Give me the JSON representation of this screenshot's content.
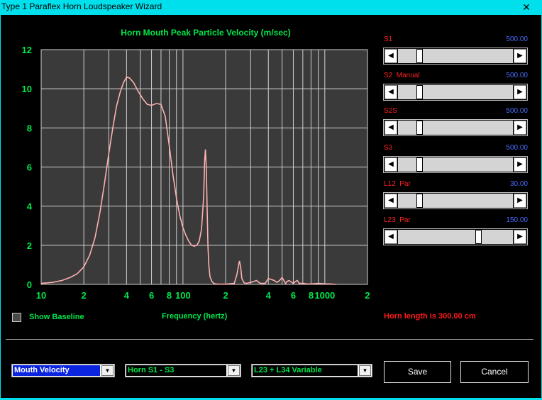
{
  "window": {
    "title": "Type 1 Paraflex Horn Loudspeaker Wizard",
    "close_glyph": "✕"
  },
  "chart_data": {
    "type": "line",
    "title": "Horn Mouth Peak Particle Velocity (m/sec)",
    "xlabel": "Frequency (hertz)",
    "ylabel": "",
    "xscale": "log",
    "xlim": [
      10,
      2000
    ],
    "ylim": [
      0,
      12
    ],
    "y_ticks": [
      "0",
      "2",
      "4",
      "6",
      "8",
      "10",
      "12"
    ],
    "x_tick_labels": [
      "10",
      "2",
      "4",
      "6",
      "8",
      "100",
      "2",
      "4",
      "6",
      "8",
      "1000",
      "2"
    ],
    "grid": true,
    "series": [
      {
        "color": "#ffb0b0",
        "x": [
          10,
          12,
          14,
          16,
          18,
          20,
          22,
          24,
          26,
          28,
          30,
          32,
          34,
          36,
          38,
          40,
          42,
          45,
          48,
          52,
          56,
          60,
          65,
          70,
          75,
          80,
          85,
          90,
          95,
          100,
          105,
          110,
          115,
          120,
          125,
          130,
          135,
          140,
          142,
          144,
          146,
          148,
          150,
          152,
          155,
          160,
          165,
          170,
          180,
          200,
          230,
          240,
          250,
          255,
          260,
          270,
          280,
          300,
          330,
          350,
          380,
          400,
          420,
          440,
          460,
          480,
          500,
          520,
          530,
          540,
          560,
          600,
          620,
          640,
          660,
          700,
          750,
          800,
          900,
          1000,
          1100,
          1200
        ],
        "y": [
          0.05,
          0.1,
          0.2,
          0.35,
          0.55,
          0.9,
          1.5,
          2.4,
          3.7,
          5.2,
          6.7,
          8.0,
          9.1,
          9.8,
          10.3,
          10.6,
          10.55,
          10.3,
          9.9,
          9.5,
          9.2,
          9.15,
          9.25,
          9.2,
          8.6,
          7.1,
          5.6,
          4.4,
          3.5,
          2.9,
          2.5,
          2.2,
          2.0,
          1.95,
          2.0,
          2.2,
          2.8,
          4.5,
          6.3,
          6.9,
          6.0,
          4.0,
          2.0,
          1.0,
          0.4,
          0.15,
          0.05,
          0.02,
          0.01,
          0.01,
          0.05,
          0.5,
          1.2,
          0.9,
          0.3,
          0.08,
          0.05,
          0.1,
          0.2,
          0.05,
          0.05,
          0.3,
          0.25,
          0.2,
          0.1,
          0.2,
          0.35,
          0.15,
          0.05,
          0.15,
          0.2,
          0.05,
          0.15,
          0.2,
          0.05,
          0.05,
          0.02,
          0.02,
          0.05,
          0.03,
          0.02,
          0.0
        ]
      }
    ]
  },
  "sliders": [
    {
      "label": "S1",
      "value": "500.00",
      "fraction": 0.17
    },
    {
      "label": "S2  Manual",
      "value": "500.00",
      "fraction": 0.17
    },
    {
      "label": "S2S",
      "value": "500.00",
      "fraction": 0.17
    },
    {
      "label": "S3",
      "value": "500.00",
      "fraction": 0.17
    },
    {
      "label": "L12  Par",
      "value": "30.00",
      "fraction": 0.17
    },
    {
      "label": "L23  Par",
      "value": "150.00",
      "fraction": 0.7
    }
  ],
  "scroll_glyphs": {
    "left": "◀",
    "right": "▶",
    "dropdown": "▼"
  },
  "show_baseline": {
    "label": "Show Baseline",
    "checked": false
  },
  "status": {
    "horn_length": "Horn length is 300.00 cm"
  },
  "combos": [
    {
      "value": "Mouth Velocity",
      "selected_highlight": true
    },
    {
      "value": "Horn S1 - S3",
      "selected_highlight": false
    },
    {
      "value": "L23 + L34 Variable",
      "selected_highlight": false
    }
  ],
  "buttons": {
    "save": "Save",
    "cancel": "Cancel"
  },
  "colors": {
    "title_bar": "#00e0ec",
    "chart_text": "#00e84a",
    "plot_bg": "#3a3a3a",
    "grid": "#d0d0d0",
    "curve": "#ffb0b0",
    "slider_label": "#ff2020",
    "slider_value": "#4a6cff",
    "combo_text": "#00e84a",
    "combo_highlight": "#0a24e0"
  }
}
